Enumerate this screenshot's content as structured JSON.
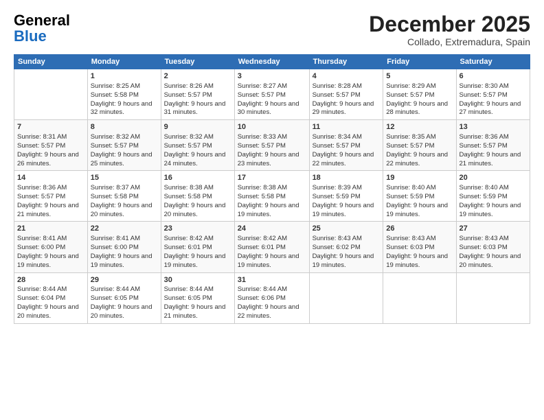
{
  "header": {
    "logo": {
      "general": "General",
      "blue": "Blue"
    },
    "title": "December 2025",
    "subtitle": "Collado, Extremadura, Spain"
  },
  "weekdays": [
    "Sunday",
    "Monday",
    "Tuesday",
    "Wednesday",
    "Thursday",
    "Friday",
    "Saturday"
  ],
  "weeks": [
    [
      {
        "day": "",
        "sunrise": "",
        "sunset": "",
        "daylight": ""
      },
      {
        "day": "1",
        "sunrise": "Sunrise: 8:25 AM",
        "sunset": "Sunset: 5:58 PM",
        "daylight": "Daylight: 9 hours and 32 minutes."
      },
      {
        "day": "2",
        "sunrise": "Sunrise: 8:26 AM",
        "sunset": "Sunset: 5:57 PM",
        "daylight": "Daylight: 9 hours and 31 minutes."
      },
      {
        "day": "3",
        "sunrise": "Sunrise: 8:27 AM",
        "sunset": "Sunset: 5:57 PM",
        "daylight": "Daylight: 9 hours and 30 minutes."
      },
      {
        "day": "4",
        "sunrise": "Sunrise: 8:28 AM",
        "sunset": "Sunset: 5:57 PM",
        "daylight": "Daylight: 9 hours and 29 minutes."
      },
      {
        "day": "5",
        "sunrise": "Sunrise: 8:29 AM",
        "sunset": "Sunset: 5:57 PM",
        "daylight": "Daylight: 9 hours and 28 minutes."
      },
      {
        "day": "6",
        "sunrise": "Sunrise: 8:30 AM",
        "sunset": "Sunset: 5:57 PM",
        "daylight": "Daylight: 9 hours and 27 minutes."
      }
    ],
    [
      {
        "day": "7",
        "sunrise": "Sunrise: 8:31 AM",
        "sunset": "Sunset: 5:57 PM",
        "daylight": "Daylight: 9 hours and 26 minutes."
      },
      {
        "day": "8",
        "sunrise": "Sunrise: 8:32 AM",
        "sunset": "Sunset: 5:57 PM",
        "daylight": "Daylight: 9 hours and 25 minutes."
      },
      {
        "day": "9",
        "sunrise": "Sunrise: 8:32 AM",
        "sunset": "Sunset: 5:57 PM",
        "daylight": "Daylight: 9 hours and 24 minutes."
      },
      {
        "day": "10",
        "sunrise": "Sunrise: 8:33 AM",
        "sunset": "Sunset: 5:57 PM",
        "daylight": "Daylight: 9 hours and 23 minutes."
      },
      {
        "day": "11",
        "sunrise": "Sunrise: 8:34 AM",
        "sunset": "Sunset: 5:57 PM",
        "daylight": "Daylight: 9 hours and 22 minutes."
      },
      {
        "day": "12",
        "sunrise": "Sunrise: 8:35 AM",
        "sunset": "Sunset: 5:57 PM",
        "daylight": "Daylight: 9 hours and 22 minutes."
      },
      {
        "day": "13",
        "sunrise": "Sunrise: 8:36 AM",
        "sunset": "Sunset: 5:57 PM",
        "daylight": "Daylight: 9 hours and 21 minutes."
      }
    ],
    [
      {
        "day": "14",
        "sunrise": "Sunrise: 8:36 AM",
        "sunset": "Sunset: 5:57 PM",
        "daylight": "Daylight: 9 hours and 21 minutes."
      },
      {
        "day": "15",
        "sunrise": "Sunrise: 8:37 AM",
        "sunset": "Sunset: 5:58 PM",
        "daylight": "Daylight: 9 hours and 20 minutes."
      },
      {
        "day": "16",
        "sunrise": "Sunrise: 8:38 AM",
        "sunset": "Sunset: 5:58 PM",
        "daylight": "Daylight: 9 hours and 20 minutes."
      },
      {
        "day": "17",
        "sunrise": "Sunrise: 8:38 AM",
        "sunset": "Sunset: 5:58 PM",
        "daylight": "Daylight: 9 hours and 19 minutes."
      },
      {
        "day": "18",
        "sunrise": "Sunrise: 8:39 AM",
        "sunset": "Sunset: 5:59 PM",
        "daylight": "Daylight: 9 hours and 19 minutes."
      },
      {
        "day": "19",
        "sunrise": "Sunrise: 8:40 AM",
        "sunset": "Sunset: 5:59 PM",
        "daylight": "Daylight: 9 hours and 19 minutes."
      },
      {
        "day": "20",
        "sunrise": "Sunrise: 8:40 AM",
        "sunset": "Sunset: 5:59 PM",
        "daylight": "Daylight: 9 hours and 19 minutes."
      }
    ],
    [
      {
        "day": "21",
        "sunrise": "Sunrise: 8:41 AM",
        "sunset": "Sunset: 6:00 PM",
        "daylight": "Daylight: 9 hours and 19 minutes."
      },
      {
        "day": "22",
        "sunrise": "Sunrise: 8:41 AM",
        "sunset": "Sunset: 6:00 PM",
        "daylight": "Daylight: 9 hours and 19 minutes."
      },
      {
        "day": "23",
        "sunrise": "Sunrise: 8:42 AM",
        "sunset": "Sunset: 6:01 PM",
        "daylight": "Daylight: 9 hours and 19 minutes."
      },
      {
        "day": "24",
        "sunrise": "Sunrise: 8:42 AM",
        "sunset": "Sunset: 6:01 PM",
        "daylight": "Daylight: 9 hours and 19 minutes."
      },
      {
        "day": "25",
        "sunrise": "Sunrise: 8:43 AM",
        "sunset": "Sunset: 6:02 PM",
        "daylight": "Daylight: 9 hours and 19 minutes."
      },
      {
        "day": "26",
        "sunrise": "Sunrise: 8:43 AM",
        "sunset": "Sunset: 6:03 PM",
        "daylight": "Daylight: 9 hours and 19 minutes."
      },
      {
        "day": "27",
        "sunrise": "Sunrise: 8:43 AM",
        "sunset": "Sunset: 6:03 PM",
        "daylight": "Daylight: 9 hours and 20 minutes."
      }
    ],
    [
      {
        "day": "28",
        "sunrise": "Sunrise: 8:44 AM",
        "sunset": "Sunset: 6:04 PM",
        "daylight": "Daylight: 9 hours and 20 minutes."
      },
      {
        "day": "29",
        "sunrise": "Sunrise: 8:44 AM",
        "sunset": "Sunset: 6:05 PM",
        "daylight": "Daylight: 9 hours and 20 minutes."
      },
      {
        "day": "30",
        "sunrise": "Sunrise: 8:44 AM",
        "sunset": "Sunset: 6:05 PM",
        "daylight": "Daylight: 9 hours and 21 minutes."
      },
      {
        "day": "31",
        "sunrise": "Sunrise: 8:44 AM",
        "sunset": "Sunset: 6:06 PM",
        "daylight": "Daylight: 9 hours and 22 minutes."
      },
      {
        "day": "",
        "sunrise": "",
        "sunset": "",
        "daylight": ""
      },
      {
        "day": "",
        "sunrise": "",
        "sunset": "",
        "daylight": ""
      },
      {
        "day": "",
        "sunrise": "",
        "sunset": "",
        "daylight": ""
      }
    ]
  ]
}
